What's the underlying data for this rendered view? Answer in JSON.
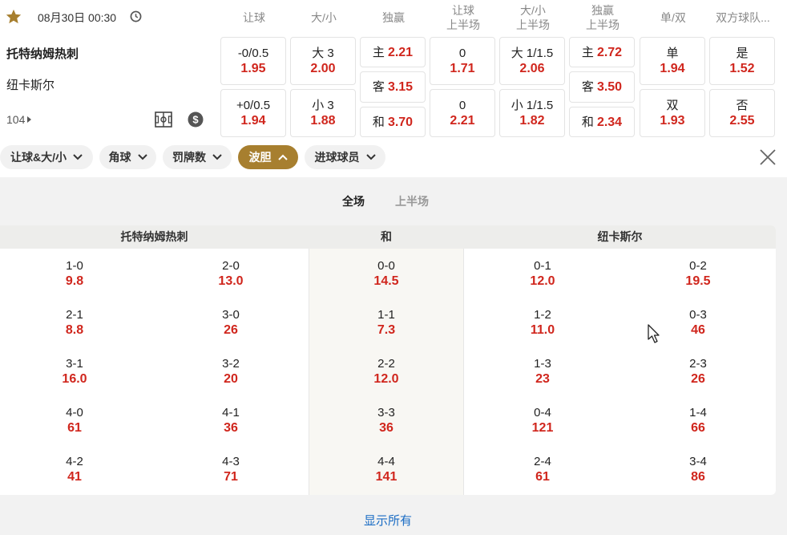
{
  "header": {
    "datetime": "08月30日 00:30",
    "columns": [
      {
        "l1": "让球",
        "l2": ""
      },
      {
        "l1": "大/小",
        "l2": ""
      },
      {
        "l1": "独赢",
        "l2": ""
      },
      {
        "l1": "让球",
        "l2": "上半场"
      },
      {
        "l1": "大/小",
        "l2": "上半场"
      },
      {
        "l1": "独赢",
        "l2": "上半场"
      },
      {
        "l1": "单/双",
        "l2": ""
      },
      {
        "l1": "双方球队...",
        "l2": ""
      }
    ]
  },
  "match": {
    "home": "托特纳姆热刺",
    "away": "纽卡斯尔",
    "more_count": "104"
  },
  "odds": {
    "handicap": [
      {
        "label": "-0/0.5",
        "value": "1.95"
      },
      {
        "label": "+0/0.5",
        "value": "1.94"
      }
    ],
    "over_under": [
      {
        "label": "大 3",
        "value": "2.00"
      },
      {
        "label": "小 3",
        "value": "1.88"
      }
    ],
    "moneyline": [
      {
        "label": "主",
        "value": "2.21"
      },
      {
        "label": "客",
        "value": "3.15"
      },
      {
        "label": "和",
        "value": "3.70"
      }
    ],
    "handicap_1h": [
      {
        "label": "0",
        "value": "1.71"
      },
      {
        "label": "0",
        "value": "2.21"
      }
    ],
    "over_under_1h": [
      {
        "label": "大 1/1.5",
        "value": "2.06"
      },
      {
        "label": "小 1/1.5",
        "value": "1.82"
      }
    ],
    "moneyline_1h": [
      {
        "label": "主",
        "value": "2.72"
      },
      {
        "label": "客",
        "value": "3.50"
      },
      {
        "label": "和",
        "value": "2.34"
      }
    ],
    "odd_even": [
      {
        "label": "单",
        "value": "1.94"
      },
      {
        "label": "双",
        "value": "1.93"
      }
    ],
    "btts": [
      {
        "label": "是",
        "value": "1.52"
      },
      {
        "label": "否",
        "value": "2.55"
      }
    ]
  },
  "filters": [
    {
      "label": "让球&大/小",
      "active": false
    },
    {
      "label": "角球",
      "active": false
    },
    {
      "label": "罚牌数",
      "active": false
    },
    {
      "label": "波胆",
      "active": true
    },
    {
      "label": "进球球员",
      "active": false
    }
  ],
  "tabs": {
    "full": "全场",
    "first_half": "上半场"
  },
  "correct_score": {
    "headers": {
      "home": "托特纳姆热刺",
      "draw": "和",
      "away": "纽卡斯尔"
    },
    "home": [
      [
        {
          "s": "1-0",
          "o": "9.8"
        },
        {
          "s": "2-0",
          "o": "13.0"
        }
      ],
      [
        {
          "s": "2-1",
          "o": "8.8"
        },
        {
          "s": "3-0",
          "o": "26"
        }
      ],
      [
        {
          "s": "3-1",
          "o": "16.0"
        },
        {
          "s": "3-2",
          "o": "20"
        }
      ],
      [
        {
          "s": "4-0",
          "o": "61"
        },
        {
          "s": "4-1",
          "o": "36"
        }
      ],
      [
        {
          "s": "4-2",
          "o": "41"
        },
        {
          "s": "4-3",
          "o": "71"
        }
      ]
    ],
    "draw": [
      {
        "s": "0-0",
        "o": "14.5"
      },
      {
        "s": "1-1",
        "o": "7.3"
      },
      {
        "s": "2-2",
        "o": "12.0"
      },
      {
        "s": "3-3",
        "o": "36"
      },
      {
        "s": "4-4",
        "o": "141"
      }
    ],
    "away": [
      [
        {
          "s": "0-1",
          "o": "12.0"
        },
        {
          "s": "0-2",
          "o": "19.5"
        }
      ],
      [
        {
          "s": "1-2",
          "o": "11.0"
        },
        {
          "s": "0-3",
          "o": "46"
        }
      ],
      [
        {
          "s": "1-3",
          "o": "23"
        },
        {
          "s": "2-3",
          "o": "26"
        }
      ],
      [
        {
          "s": "0-4",
          "o": "121"
        },
        {
          "s": "1-4",
          "o": "66"
        }
      ],
      [
        {
          "s": "2-4",
          "o": "61"
        },
        {
          "s": "3-4",
          "o": "86"
        }
      ]
    ],
    "show_all": "显示所有"
  },
  "colors": {
    "accent": "#a77f2f",
    "odds_red": "#d0261d",
    "link_blue": "#1a6cc4"
  }
}
